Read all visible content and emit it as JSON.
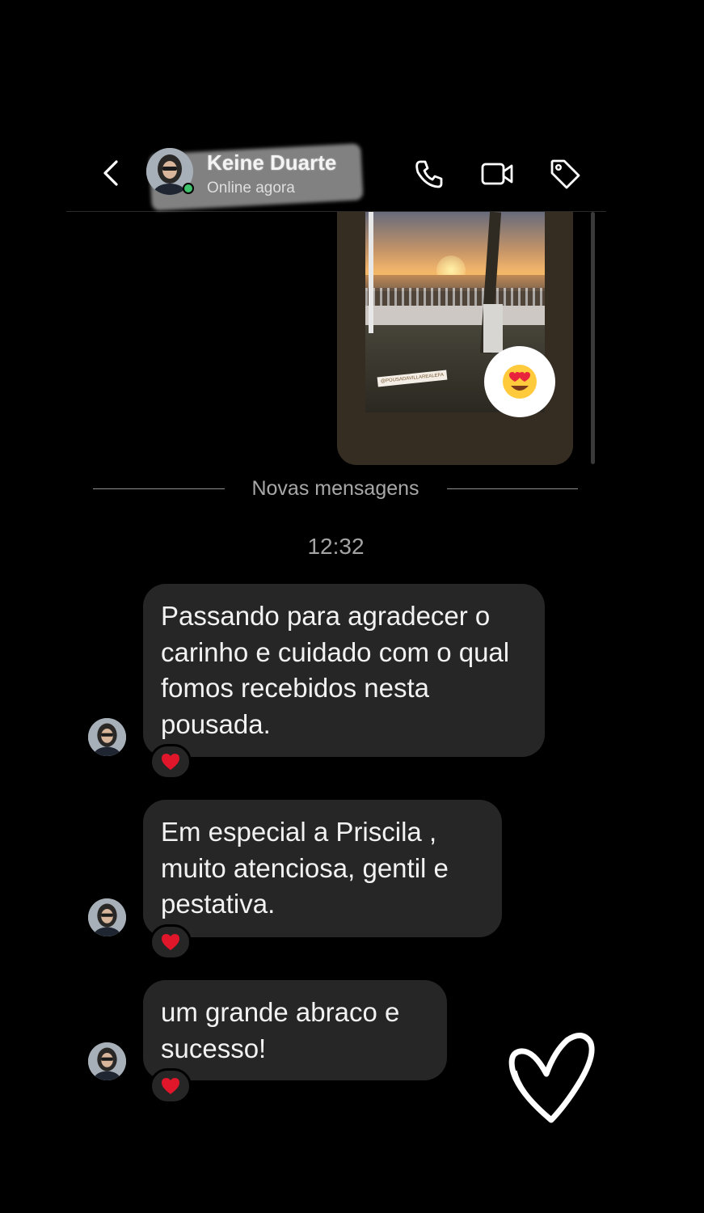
{
  "header": {
    "contact_name": "Keine Duarte",
    "status": "Online agora",
    "icons": [
      "chevron-left-icon",
      "phone-icon",
      "video-camera-icon",
      "tag-icon"
    ]
  },
  "shared_story": {
    "watermark": "@POUSADAVILLAREALEFA",
    "reaction": "😍"
  },
  "divider": {
    "label": "Novas mensagens"
  },
  "timestamp": "12:32",
  "messages": [
    {
      "text": "Passando para agradecer o carinho e cuidado com o qual fomos recebidos nesta pousada.",
      "reaction": "❤️"
    },
    {
      "text": "Em especial a Priscila , muito atenciosa, gentil e pestativa.",
      "reaction": "❤️"
    },
    {
      "text": "um grande abraco e sucesso!",
      "reaction": "❤️"
    }
  ],
  "colors": {
    "background": "#000000",
    "bubble": "#262626",
    "online": "#3ec26b",
    "heart": "#e0162b"
  }
}
